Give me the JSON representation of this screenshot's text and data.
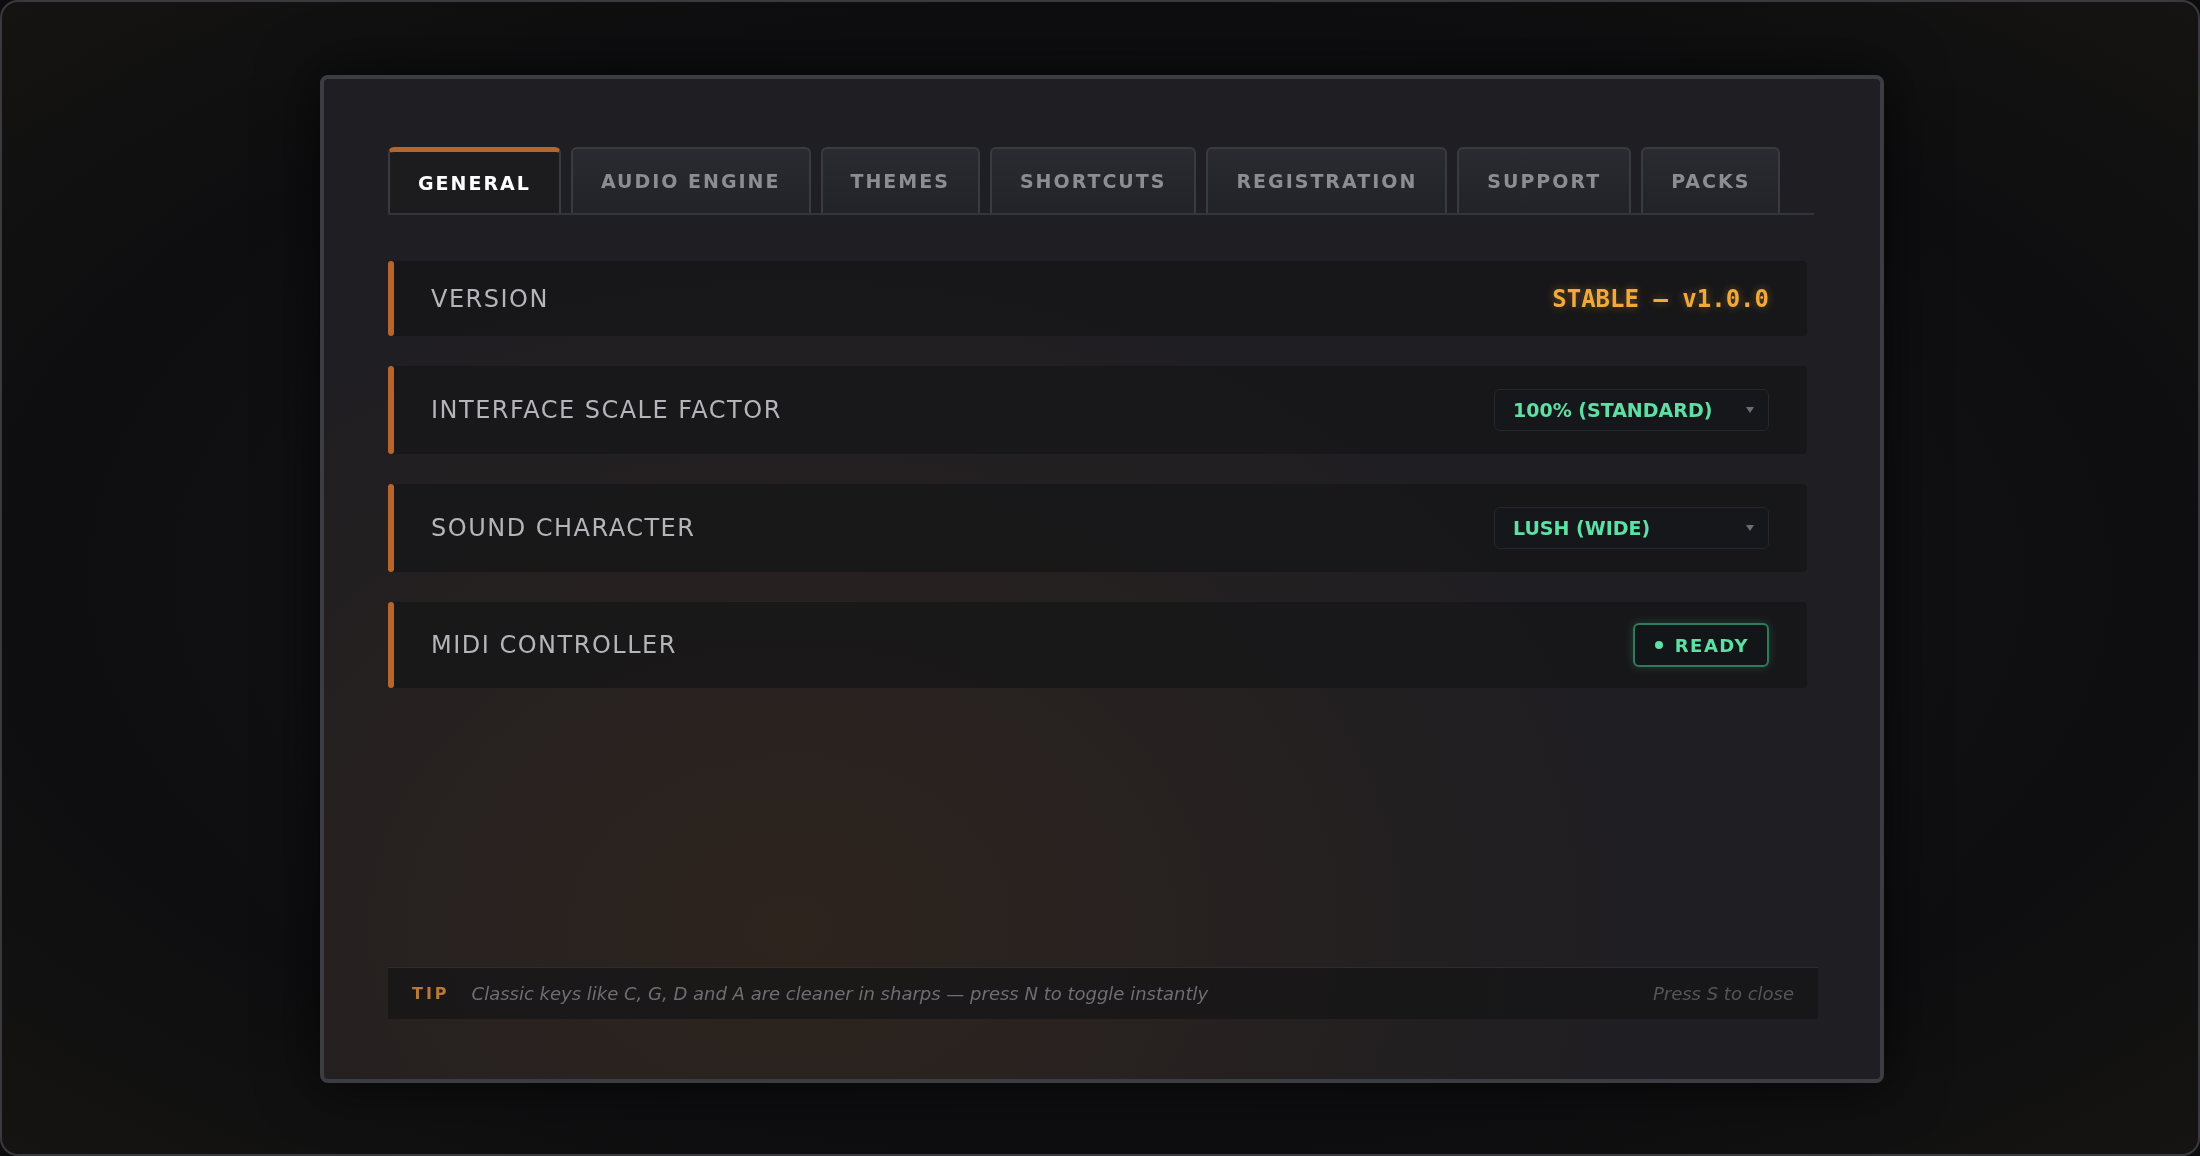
{
  "tabs": [
    {
      "label": "GENERAL",
      "selected": true
    },
    {
      "label": "AUDIO ENGINE",
      "selected": false
    },
    {
      "label": "THEMES",
      "selected": false
    },
    {
      "label": "SHORTCUTS",
      "selected": false
    },
    {
      "label": "REGISTRATION",
      "selected": false
    },
    {
      "label": "SUPPORT",
      "selected": false
    },
    {
      "label": "PACKS",
      "selected": false
    }
  ],
  "settings": [
    {
      "kind": "text",
      "label": "VERSION",
      "value": "STABLE — v1.0.0"
    },
    {
      "kind": "select",
      "label": "INTERFACE SCALE FACTOR",
      "value": "100% (STANDARD)"
    },
    {
      "kind": "select",
      "label": "SOUND CHARACTER",
      "value": "LUSH (WIDE)"
    },
    {
      "kind": "status",
      "label": "MIDI CONTROLLER",
      "value": "READY"
    }
  ],
  "tip": {
    "label": "TIP",
    "text": "Classic keys like C, G, D and A are cleaner in sharps — press N to toggle instantly",
    "hint": "Press S to close"
  }
}
